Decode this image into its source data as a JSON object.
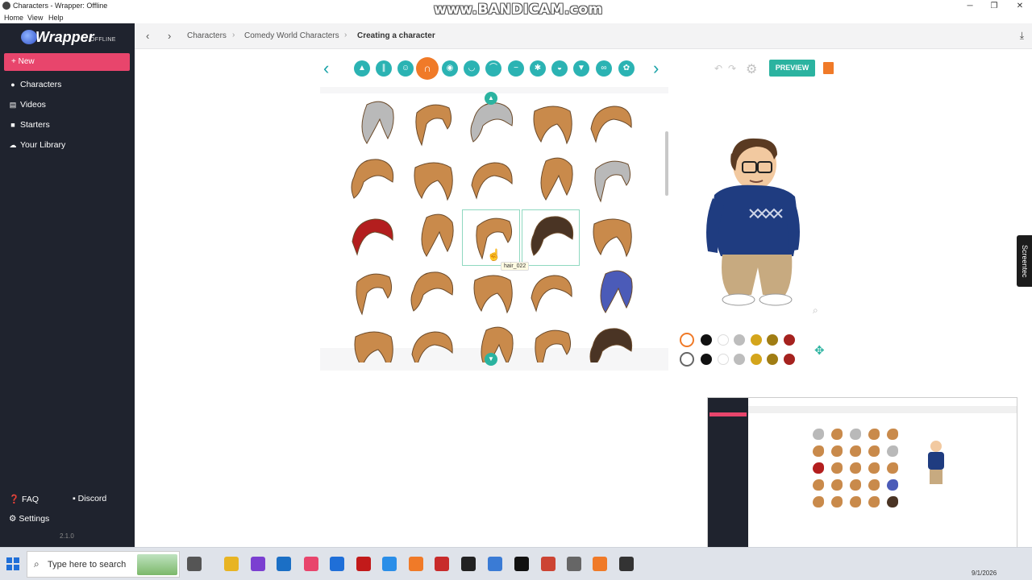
{
  "window": {
    "title": "Characters - Wrapper: Offline",
    "menu": [
      "Home",
      "View",
      "Help"
    ],
    "watermark": "www.BANDICAM.com"
  },
  "sidebar": {
    "logo_word": "Wrapper",
    "logo_sub": "OFFLINE",
    "new_label": "New",
    "items": [
      {
        "label": "Characters",
        "icon": "user-icon"
      },
      {
        "label": "Videos",
        "icon": "film-icon"
      },
      {
        "label": "Starters",
        "icon": "briefcase-icon"
      },
      {
        "label": "Your Library",
        "icon": "cloud-icon"
      }
    ],
    "faq_label": "FAQ",
    "discord_label": "Discord",
    "settings_label": "Settings",
    "version": "2.1.0"
  },
  "breadcrumb": {
    "items": [
      "Characters",
      "Comedy World Characters"
    ],
    "current": "Creating a character"
  },
  "toolbar": {
    "preview_label": "PREVIEW",
    "categories": [
      "shirt-icon",
      "pants-icon",
      "face-icon",
      "hair-icon",
      "head-icon",
      "mouth-icon",
      "eyebrow-icon",
      "nose-icon",
      "ear-icon",
      "eye-icon",
      "beard-icon",
      "glasses-icon",
      "accessory-icon"
    ],
    "active_category": "hair-icon"
  },
  "hair_grid": {
    "tooltip": "hair_022",
    "selected_index": 12,
    "hovered_index": 13,
    "colors": {
      "hair": "#c98a4b",
      "dark": "#4a3424",
      "red": "#b31e1e",
      "gray": "#b9b9b9",
      "blue": "#4b5bb8"
    }
  },
  "color_rows": [
    [
      "#111111",
      "#ffffff",
      "#bdbdbd",
      "#d4a51c",
      "#a07d14",
      "#a5221f"
    ],
    [
      "#111111",
      "#ffffff",
      "#bdbdbd",
      "#d4a51c",
      "#a07d14",
      "#a5221f"
    ]
  ],
  "screencast_tab": "Screentec",
  "taskbar": {
    "search_placeholder": "Type here to search",
    "date": "9/1/2026"
  }
}
